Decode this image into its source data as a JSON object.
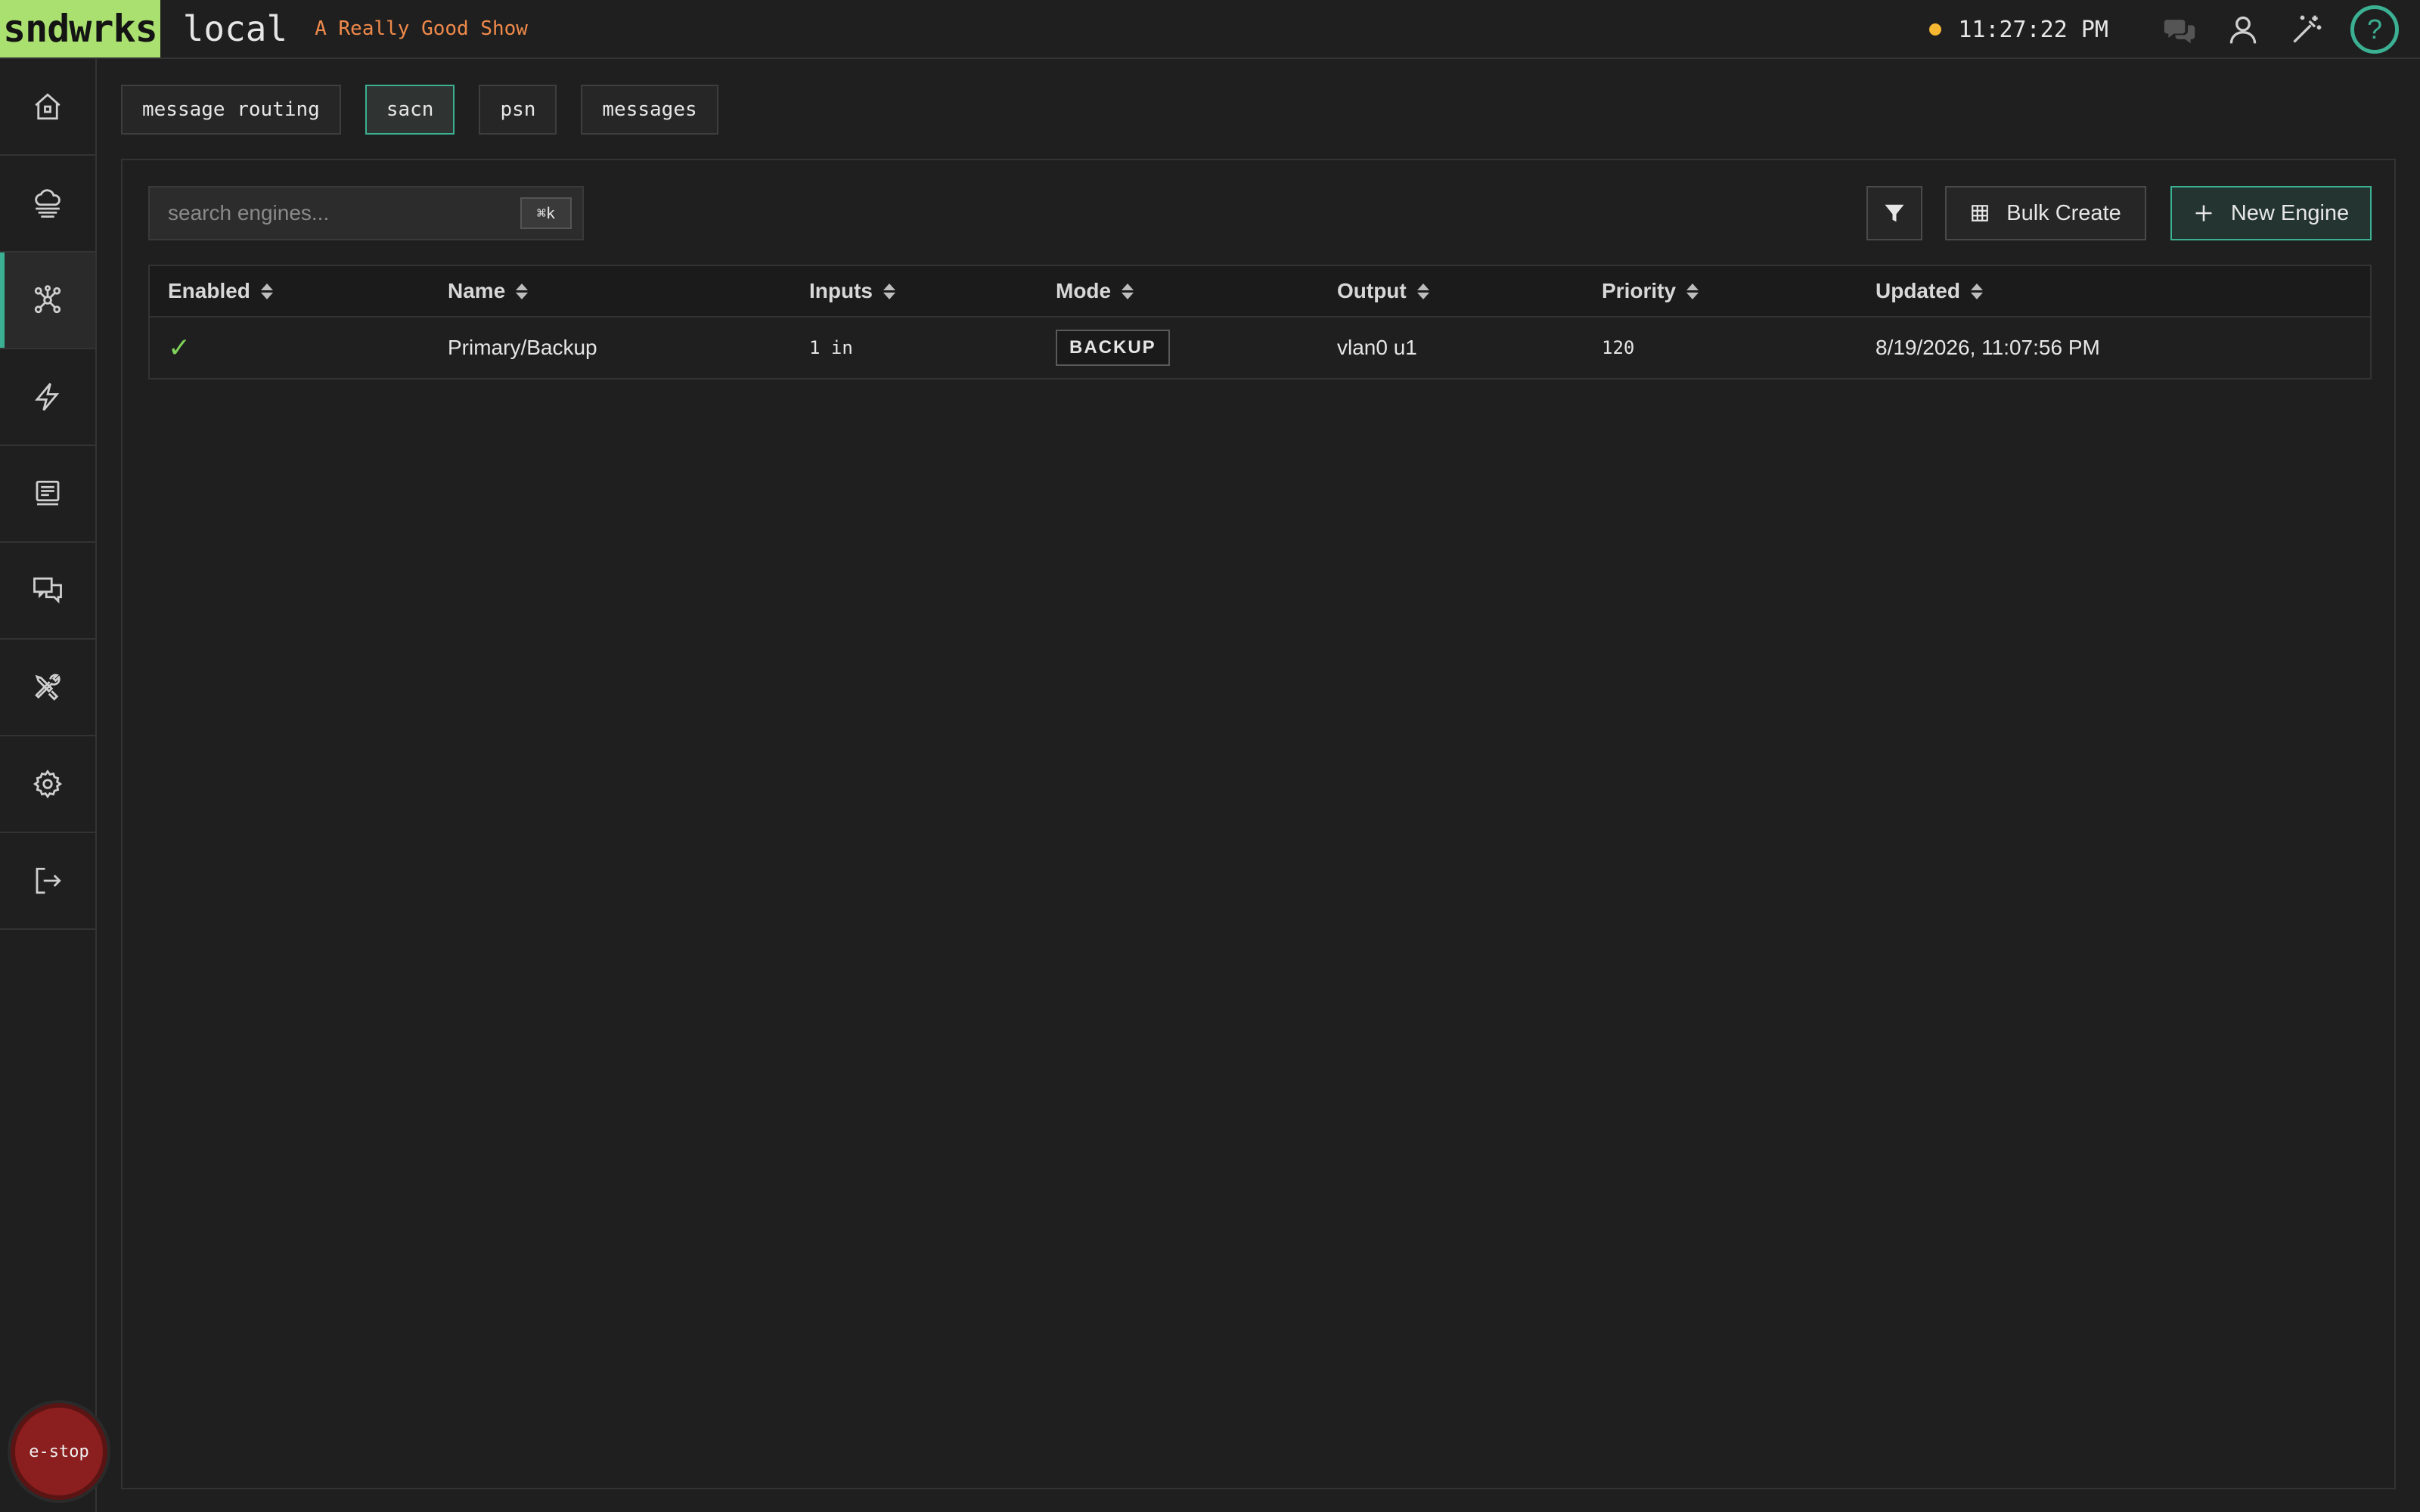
{
  "header": {
    "brand": "sndwrks",
    "instance": "local",
    "show_name": "A Really Good Show",
    "clock": "11:27:22 PM",
    "status_color": "#f5b731",
    "icons": [
      "chat-icon",
      "user-icon",
      "magic-wand-icon",
      "help-icon"
    ],
    "help_glyph": "?"
  },
  "sidebar": {
    "items": [
      {
        "name": "home",
        "icon": "home-icon"
      },
      {
        "name": "cloud",
        "icon": "cloud-stack-icon"
      },
      {
        "name": "engines",
        "icon": "network-nodes-icon",
        "active": true
      },
      {
        "name": "triggers",
        "icon": "lightning-icon"
      },
      {
        "name": "presentation",
        "icon": "presentation-icon"
      },
      {
        "name": "messages",
        "icon": "chat-screens-icon"
      },
      {
        "name": "tools",
        "icon": "tools-icon"
      },
      {
        "name": "settings",
        "icon": "gear-icon"
      },
      {
        "name": "logout",
        "icon": "logout-icon"
      }
    ],
    "estop_label": "e-stop"
  },
  "tabs": [
    {
      "label": "message routing",
      "active": false
    },
    {
      "label": "sacn",
      "active": true
    },
    {
      "label": "psn",
      "active": false
    },
    {
      "label": "messages",
      "active": false
    }
  ],
  "toolbar": {
    "search_placeholder": "search engines...",
    "search_value": "",
    "shortcut": "⌘k",
    "bulk_create_label": "Bulk Create",
    "new_engine_label": "New Engine"
  },
  "table": {
    "columns": [
      "Enabled",
      "Name",
      "Inputs",
      "Mode",
      "Output",
      "Priority",
      "Updated"
    ],
    "rows": [
      {
        "enabled": "✓",
        "name": "Primary/Backup",
        "inputs": "1 in",
        "mode": "BACKUP",
        "output": "vlan0 u1",
        "priority": "120",
        "updated": "8/19/2026, 11:07:56 PM"
      }
    ]
  },
  "colors": {
    "accent": "#3bb092",
    "brand_bg": "#a9e06f",
    "show_name": "#f08a4b",
    "estop": "#8b1e1e",
    "check": "#7fd35a"
  }
}
